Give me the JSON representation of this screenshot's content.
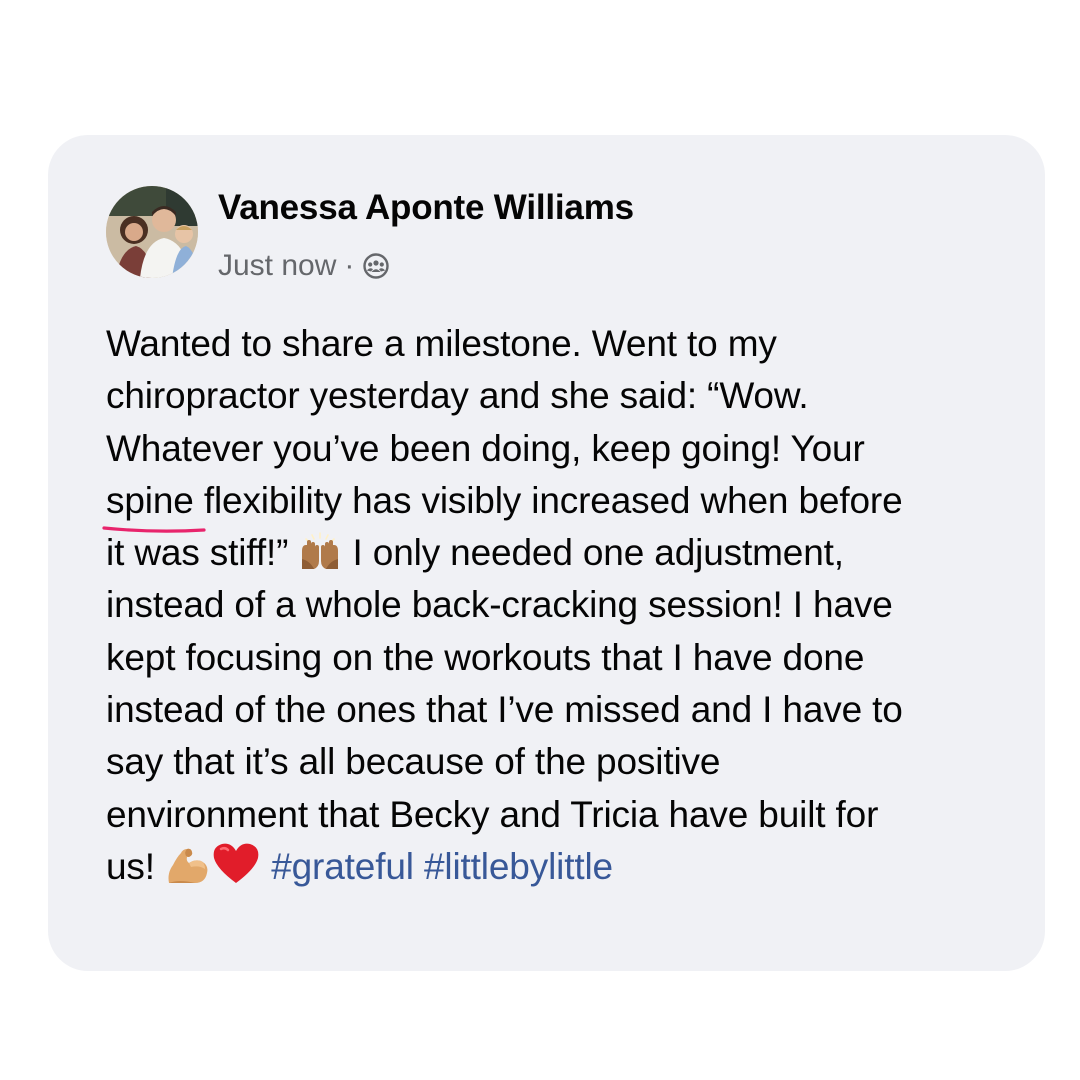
{
  "post": {
    "author": "Vanessa Aponte Williams",
    "timestamp": "Just now",
    "separator": "·",
    "audience_icon": "group-icon",
    "body_lines": [
      "Wanted to share a milestone. Went to my",
      "chiropractor yesterday and she said: “Wow.",
      "Whatever you’ve been doing, keep going! Your"
    ],
    "highlighted_text": "spine flexibility has visibly increased",
    "line4_rest": " when before",
    "line5_start": "it was stiff!”",
    "line5_end": " I only needed one adjustment,",
    "body_lines_2": [
      "instead of a whole back-cracking session! I have",
      "kept focusing on the workouts that I have done",
      "instead of the ones that I’ve missed and I have to",
      "say that it’s all because of the positive",
      "environment that Becky and Tricia have built for"
    ],
    "final_start": "us!",
    "hashtags": [
      "#grateful",
      "#littlebylittle"
    ],
    "emojis": [
      "raised-hands-emoji",
      "flexed-biceps-emoji",
      "red-heart-emoji"
    ]
  },
  "colors": {
    "card_background": "#f0f1f5",
    "text": "#050505",
    "meta_text": "#65676b",
    "hashtag": "#385898",
    "highlight_underline": "#e8246c"
  }
}
